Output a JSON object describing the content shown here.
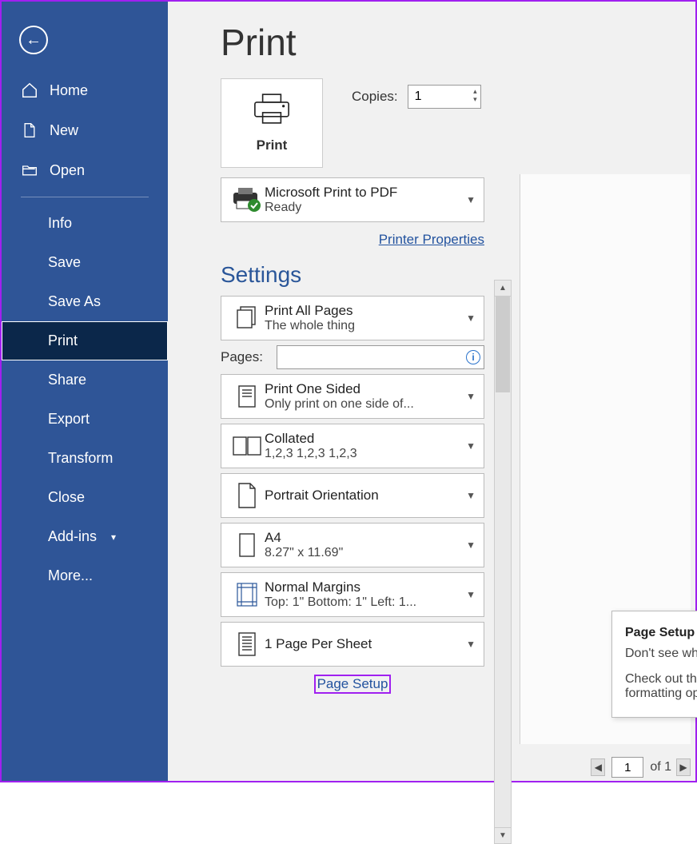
{
  "sidebar": {
    "home": "Home",
    "new": "New",
    "open": "Open",
    "info": "Info",
    "save": "Save",
    "saveas": "Save As",
    "print": "Print",
    "share": "Share",
    "export": "Export",
    "transform": "Transform",
    "close": "Close",
    "addins": "Add-ins",
    "more": "More..."
  },
  "title": "Print",
  "print_button": "Print",
  "copies_label": "Copies:",
  "copies_value": "1",
  "printer": {
    "name": "Microsoft Print to PDF",
    "status": "Ready"
  },
  "printer_props": "Printer Properties",
  "settings_title": "Settings",
  "print_what": {
    "l1": "Print All Pages",
    "l2": "The whole thing"
  },
  "pages_label": "Pages:",
  "sided": {
    "l1": "Print One Sided",
    "l2": "Only print on one side of..."
  },
  "collate": {
    "l1": "Collated",
    "l2": "1,2,3    1,2,3    1,2,3"
  },
  "orientation": {
    "l1": "Portrait Orientation"
  },
  "paper": {
    "l1": "A4",
    "l2": "8.27\" x 11.69\""
  },
  "margins": {
    "l1": "Normal Margins",
    "l2": "Top: 1\" Bottom: 1\" Left: 1..."
  },
  "perpage": {
    "l1": "1 Page Per Sheet"
  },
  "page_setup": "Page Setup",
  "footer": {
    "page": "1",
    "of": "of 1"
  },
  "tooltip": {
    "title": "Page Setup",
    "l1": "Don't see what you're looking for?",
    "l2": "Check out the full set of page formatting options."
  }
}
